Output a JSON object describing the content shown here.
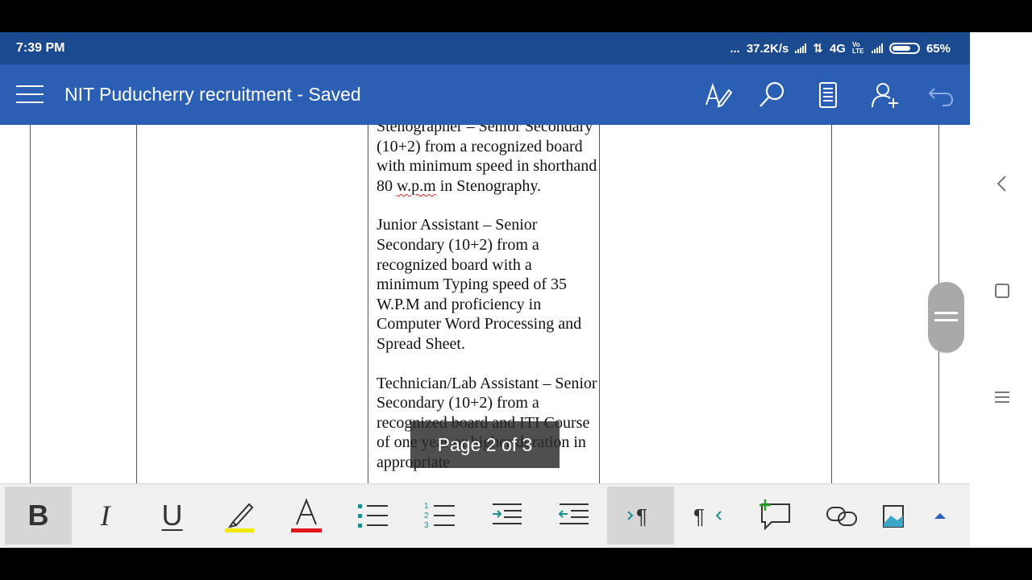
{
  "status": {
    "time": "7:39 PM",
    "dots": "...",
    "net_speed": "37.2K/s",
    "network": "4G",
    "volte": "Vo LTE",
    "battery": "65%"
  },
  "app": {
    "title": "NIT Puducherry recruitment - Saved",
    "icons": [
      "draw-icon",
      "search-icon",
      "reading-view-icon",
      "share-person-icon",
      "undo-icon"
    ]
  },
  "document": {
    "line_partial": "Stenographer – Senior",
    "para1_rest_a": "Secondary (10+2) from a recognized board with minimum speed in shorthand 80 ",
    "para1_misspelled": "w.p.m",
    "para1_rest_b": " in Stenography.",
    "para2": "Junior Assistant – Senior Secondary (10+2) from a recognized board with a minimum Typing speed of 35 W.P.M and proficiency in Computer Word Processing and Spread Sheet.",
    "para3": "Technician/Lab Assistant – Senior Secondary (10+2) from a recognized board and ITI Course of one year or higher duration in appropriate"
  },
  "page_indicator": "Page 2 of 3",
  "toolbar": {
    "bold": "B",
    "italic": "I",
    "underline": "U",
    "highlight_color": "#f3e800",
    "font_color": "#e0161b",
    "font_color_letter": "A",
    "accent": "#1e8f8f"
  },
  "nav": {
    "back": "back-icon",
    "home": "home-icon",
    "recents": "recents-icon"
  }
}
